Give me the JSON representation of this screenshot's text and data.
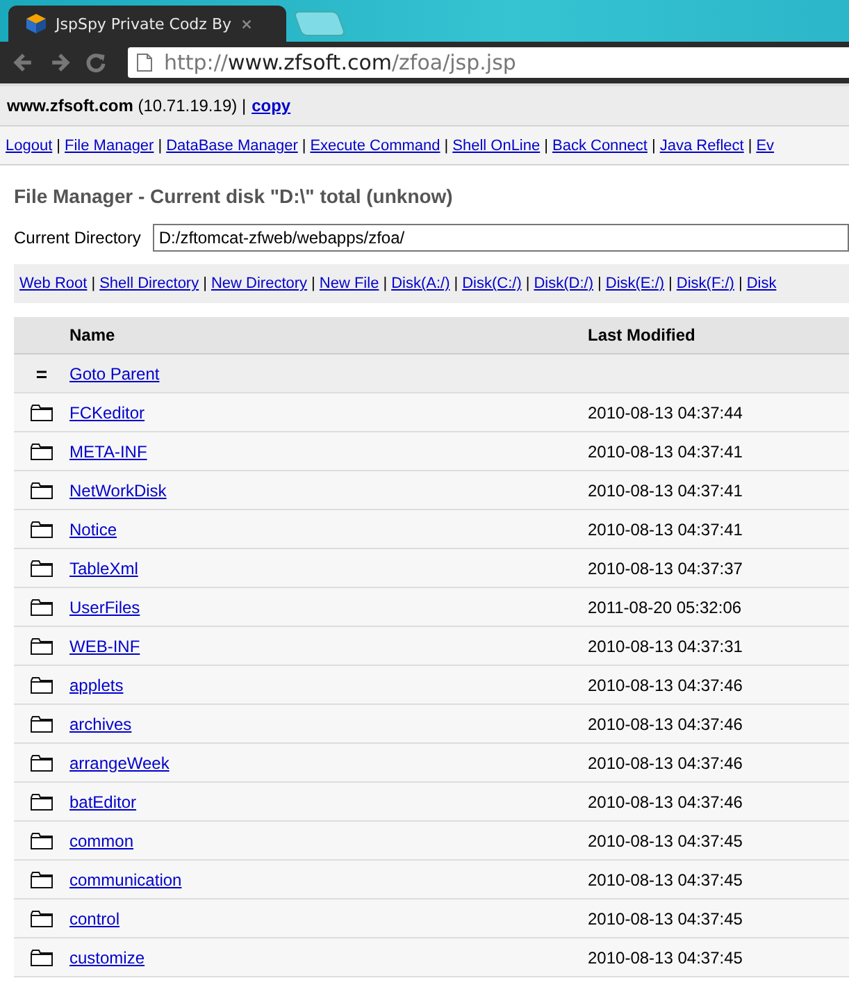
{
  "browser": {
    "tab_title": "JspSpy Private Codz By",
    "url": {
      "scheme": "http://",
      "host": "www.zfsoft.com",
      "path": "/zfoa/jsp.jsp"
    }
  },
  "info": {
    "text": "**www.zfsoft.com** (10.71.19.19) |",
    "link": "copy"
  },
  "separator": "|",
  "nav": [
    "Logout",
    "File Manager",
    "DataBase Manager",
    "Execute Command",
    "Shell OnLine",
    "Back Connect",
    "Java Reflect",
    "Ev"
  ],
  "title": "File Manager - Current disk \"D:\\\" total (unknow)",
  "current_directory": {
    "label": "Current Directory",
    "value": "D:/zftomcat-zfweb/webapps/zfoa/"
  },
  "shortcuts": [
    "Web Root",
    "Shell Directory",
    "New Directory",
    "New File",
    "Disk(A:/)",
    "Disk(C:/)",
    "Disk(D:/)",
    "Disk(E:/)",
    "Disk(F:/)",
    "Disk"
  ],
  "table": {
    "columns": [
      "Name",
      "Last Modified"
    ],
    "rows": [
      {
        "kind": "parent",
        "icon": "=",
        "name": "Goto Parent"
      },
      {
        "kind": "folder",
        "name": "FCKeditor",
        "modified": "2010-08-13 04:37:44"
      },
      {
        "kind": "folder",
        "name": "META-INF",
        "modified": "2010-08-13 04:37:41"
      },
      {
        "kind": "folder",
        "name": "NetWorkDisk",
        "modified": "2010-08-13 04:37:41"
      },
      {
        "kind": "folder",
        "name": "Notice",
        "modified": "2010-08-13 04:37:41"
      },
      {
        "kind": "folder",
        "name": "TableXml",
        "modified": "2010-08-13 04:37:37"
      },
      {
        "kind": "folder",
        "name": "UserFiles",
        "modified": "2011-08-20 05:32:06"
      },
      {
        "kind": "folder",
        "name": "WEB-INF",
        "modified": "2010-08-13 04:37:31"
      },
      {
        "kind": "folder",
        "name": "applets",
        "modified": "2010-08-13 04:37:46"
      },
      {
        "kind": "folder",
        "name": "archives",
        "modified": "2010-08-13 04:37:46"
      },
      {
        "kind": "folder",
        "name": "arrangeWeek",
        "modified": "2010-08-13 04:37:46"
      },
      {
        "kind": "folder",
        "name": "batEditor",
        "modified": "2010-08-13 04:37:46"
      },
      {
        "kind": "folder",
        "name": "common",
        "modified": "2010-08-13 04:37:45"
      },
      {
        "kind": "folder",
        "name": "communication",
        "modified": "2010-08-13 04:37:45"
      },
      {
        "kind": "folder",
        "name": "control",
        "modified": "2010-08-13 04:37:45"
      },
      {
        "kind": "folder",
        "name": "customize",
        "modified": "2010-08-13 04:37:45"
      }
    ]
  }
}
